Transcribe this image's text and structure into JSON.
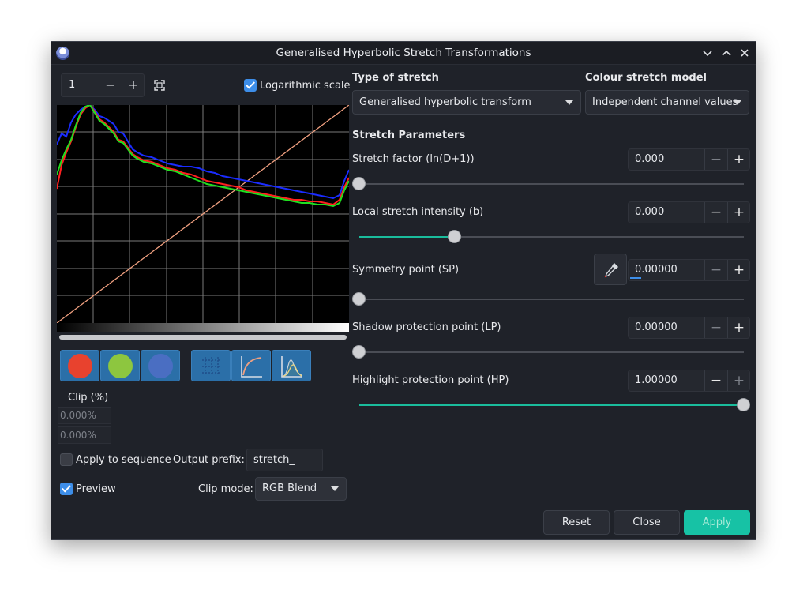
{
  "window": {
    "title": "Generalised Hyperbolic Stretch Transformations"
  },
  "colors": {
    "accent": "#1abc9c",
    "checkbox": "#3d8ee9",
    "tool_button": "#2b6fa8",
    "red_channel": "#e8422e",
    "green_channel": "#8dc63f",
    "blue_channel": "#4a6ec2",
    "apply": "#17c2a5"
  },
  "histogram": {
    "zoom_value": "1",
    "zoom_minus": "−",
    "zoom_plus": "+",
    "log_scale_label": "Logarithmic scale",
    "log_scale_checked": true
  },
  "stretch": {
    "type_label": "Type of stretch",
    "type_value": "Generalised hyperbolic transform",
    "model_label": "Colour stretch model",
    "model_value": "Independent channel values",
    "params_label": "Stretch Parameters",
    "params": [
      {
        "label": "Stretch factor (ln(D+1))",
        "value": "0.000",
        "level": 0.0
      },
      {
        "label": "Local stretch intensity (b)",
        "value": "0.000",
        "level": 0.25
      },
      {
        "label": "Symmetry point (SP)",
        "value": "0.00000",
        "level": 0.0
      },
      {
        "label": "Shadow protection point (LP)",
        "value": "0.00000",
        "level": 0.0
      },
      {
        "label": "Highlight protection point (HP)",
        "value": "1.00000",
        "level": 1.0
      }
    ],
    "minus": "−",
    "plus": "+"
  },
  "clip": {
    "label": "Clip (%)",
    "low": "0.000%",
    "high": "0.000%"
  },
  "sequence": {
    "apply_label": "Apply to sequence",
    "apply_checked": false,
    "prefix_label": "Output prefix:",
    "prefix_value": "stretch_"
  },
  "preview": {
    "label": "Preview",
    "checked": true,
    "clip_mode_label": "Clip mode:",
    "clip_mode_value": "RGB Blend"
  },
  "buttons": {
    "reset": "Reset",
    "close": "Close",
    "apply": "Apply"
  }
}
